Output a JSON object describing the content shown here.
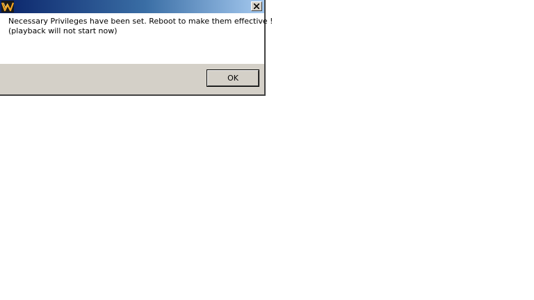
{
  "dialog": {
    "title": "",
    "message_line1": "Necessary Privileges have been set. Reboot to make them effective !",
    "message_line2": "(playback will not start now)",
    "ok_label": "OK",
    "icons": {
      "app": "app-logo-icon",
      "close": "close-icon"
    },
    "colors": {
      "titlebar_start": "#0a246a",
      "titlebar_end": "#a6caf0",
      "face": "#d4d0c8",
      "content": "#ffffff"
    }
  }
}
